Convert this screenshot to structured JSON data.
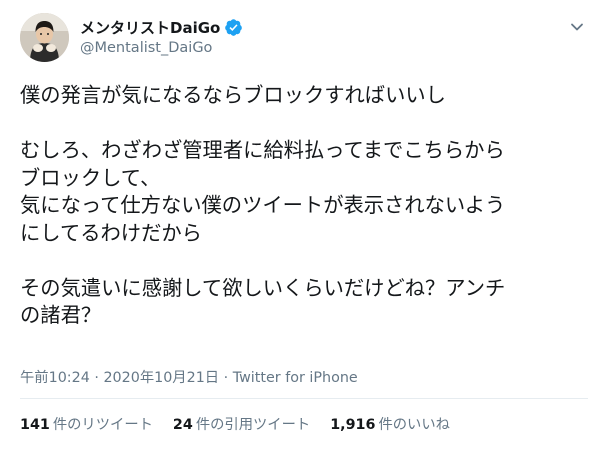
{
  "user": {
    "display_name": "メンタリストDaiGo",
    "handle": "@Mentalist_DaiGo"
  },
  "tweet": {
    "lines": [
      "僕の発言が気になるならブロックすればいいし",
      "",
      "むしろ、わざわざ管理者に給料払ってまでこちらから",
      "ブロックして、",
      "気になって仕方ない僕のツイートが表示されないよう",
      "にしてるわけだから",
      "",
      "その気遣いに感謝して欲しいくらいだけどね？アンチ",
      "の諸君？"
    ]
  },
  "meta": {
    "time": "午前10:24",
    "separator1": " · ",
    "date": "2020年10月21日",
    "separator2": " · ",
    "source": "Twitter for iPhone"
  },
  "stats": {
    "retweets_count": "141",
    "retweets_label": "件のリツイート",
    "quotes_count": "24",
    "quotes_label": "件の引用ツイート",
    "likes_count": "1,916",
    "likes_label": "件のいいね"
  },
  "colors": {
    "text": "#14171a",
    "secondary": "#657786",
    "verified": "#1da1f2",
    "divider": "#e6ecf0"
  },
  "icons": {
    "verified": "verified-badge-icon",
    "caret": "chevron-down-icon"
  }
}
